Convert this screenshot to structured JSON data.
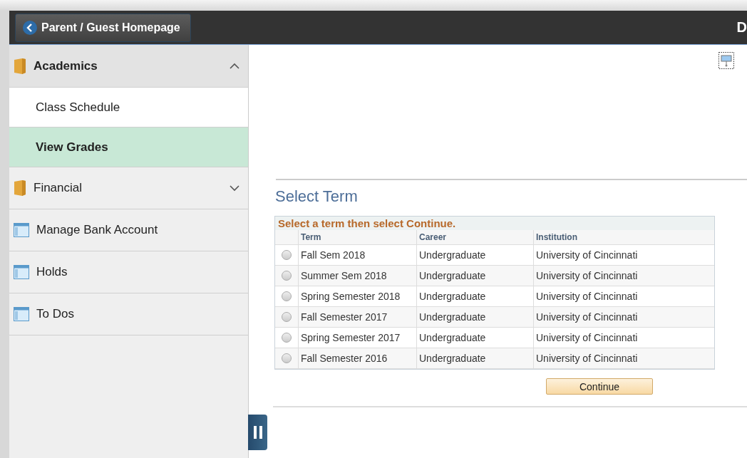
{
  "header": {
    "back_button": "Parent / Guest Homepage",
    "title": "D"
  },
  "sidebar": {
    "items": [
      {
        "kind": "folder",
        "label": "Academics",
        "expanded": true,
        "children": [
          {
            "label": "Class Schedule",
            "selected": false
          },
          {
            "label": "View Grades",
            "selected": true
          }
        ]
      },
      {
        "kind": "folder",
        "label": "Financial",
        "expanded": false
      },
      {
        "kind": "page",
        "label": "Manage Bank Account"
      },
      {
        "kind": "page",
        "label": "Holds"
      },
      {
        "kind": "page",
        "label": "To Dos"
      }
    ]
  },
  "content": {
    "heading": "Select Term",
    "instruction": "Select a term then select Continue.",
    "table": {
      "columns": [
        "Term",
        "Career",
        "Institution"
      ],
      "rows": [
        {
          "selected": false,
          "cells": [
            "Fall Sem 2018",
            "Undergraduate",
            "University of Cincinnati"
          ]
        },
        {
          "selected": false,
          "cells": [
            "Summer Sem 2018",
            "Undergraduate",
            "University of Cincinnati"
          ]
        },
        {
          "selected": false,
          "cells": [
            "Spring Semester 2018",
            "Undergraduate",
            "University of Cincinnati"
          ]
        },
        {
          "selected": false,
          "cells": [
            "Fall Semester 2017",
            "Undergraduate",
            "University of Cincinnati"
          ]
        },
        {
          "selected": false,
          "cells": [
            "Spring Semester 2017",
            "Undergraduate",
            "University of Cincinnati"
          ]
        },
        {
          "selected": false,
          "cells": [
            "Fall Semester 2016",
            "Undergraduate",
            "University of Cincinnati"
          ]
        }
      ]
    },
    "button": "Continue"
  }
}
